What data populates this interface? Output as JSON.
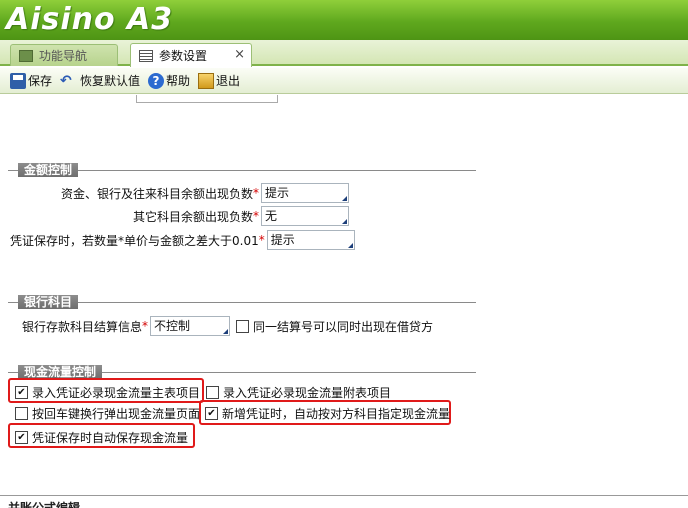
{
  "app": {
    "logo": "Aisino A3"
  },
  "tabs": [
    {
      "label": "功能导航",
      "active": false
    },
    {
      "label": "参数设置",
      "active": true,
      "close": "×"
    }
  ],
  "toolbar": {
    "save": "保存",
    "restore": "恢复默认值",
    "help": "帮助",
    "exit": "退出"
  },
  "cut_row": {
    "label": "…",
    "value": ""
  },
  "amount_control": {
    "title": "金额控制",
    "rows": [
      {
        "label": "资金、银行及往来科目余额出现负数",
        "required": "*",
        "value": "提示"
      },
      {
        "label": "其它科目余额出现负数",
        "required": "*",
        "value": "无"
      },
      {
        "label": "凭证保存时，若数量*单价与金额之差大于0.01",
        "required": "*",
        "value": "提示"
      }
    ]
  },
  "bank_account": {
    "title": "银行科目",
    "settle_label": "银行存款科目结算信息",
    "required": "*",
    "settle_value": "不控制",
    "same_settle_label": "同一结算号可以同时出现在借贷方",
    "same_settle_checked": false
  },
  "cash_flow": {
    "title": "现金流量控制",
    "main_item": {
      "label": "录入凭证必录现金流量主表项目",
      "checked": true
    },
    "sub_item": {
      "label": "录入凭证必录现金流量附表项目",
      "checked": false
    },
    "enter_popup": {
      "label": "按回车键换行弹出现金流量页面",
      "checked": false
    },
    "auto_assign": {
      "label": "新增凭证时，自动按对方科目指定现金流量",
      "checked": true
    },
    "auto_save": {
      "label": "凭证保存时自动保存现金流量",
      "checked": true
    }
  },
  "bottom_section": {
    "title": "并账公式编辑"
  },
  "colors": {
    "banner": "#5fa81e",
    "highlight": "#e01a1a",
    "section_head": "#7a7a7a"
  }
}
